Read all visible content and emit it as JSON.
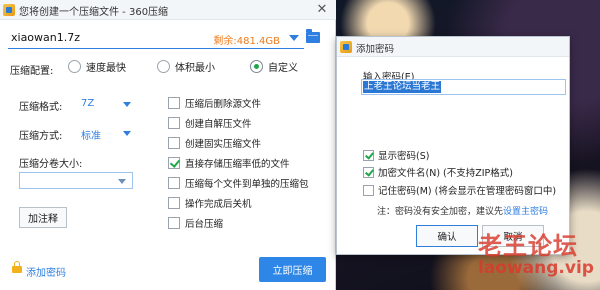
{
  "main_window": {
    "title": "您将创建一个压缩文件 - 360压缩",
    "close_glyph": "✕",
    "file_name": "xiaowan1.7z",
    "free_space": "剩余:481.4GB",
    "config_label": "压缩配置:",
    "config_options": [
      {
        "label": "速度最快",
        "selected": false
      },
      {
        "label": "体积最小",
        "selected": false
      },
      {
        "label": "自定义",
        "selected": true
      }
    ],
    "format_label": "压缩格式:",
    "format_value": "7Z",
    "method_label": "压缩方式:",
    "method_value": "标准",
    "volume_label": "压缩分卷大小:",
    "volume_value": "",
    "comment_button": "加注释",
    "options": [
      {
        "label": "压缩后删除源文件",
        "checked": false
      },
      {
        "label": "创建自解压文件",
        "checked": false
      },
      {
        "label": "创建固实压缩文件",
        "checked": false
      },
      {
        "label": "直接存储压缩率低的文件",
        "checked": true
      },
      {
        "label": "压缩每个文件到单独的压缩包",
        "checked": false
      },
      {
        "label": "操作完成后关机",
        "checked": false
      },
      {
        "label": "后台压缩",
        "checked": false
      }
    ],
    "add_password_link": "添加密码",
    "start_button": "立即压缩"
  },
  "password_dialog": {
    "title": "添加密码",
    "input_label": "输入密码(E)",
    "password_value": "上老王论坛当老王",
    "options": [
      {
        "label": "显示密码(S)",
        "checked": true
      },
      {
        "label": "加密文件名(N) (不支持ZIP格式)",
        "checked": true
      },
      {
        "label": "记住密码(M) (将会显示在管理密码窗口中)",
        "checked": false
      }
    ],
    "note_text": "注：密码没有安全加密，建议先",
    "note_link": "设置主密码",
    "ok_button": "确认",
    "cancel_button": "取消"
  },
  "watermark": {
    "line1": "老王论坛",
    "line2": "laowang.vip"
  },
  "colors": {
    "accent": "#2e86e6",
    "free_space": "#f07a1a",
    "check": "#1ea84a",
    "watermark": "#d93a2b"
  }
}
